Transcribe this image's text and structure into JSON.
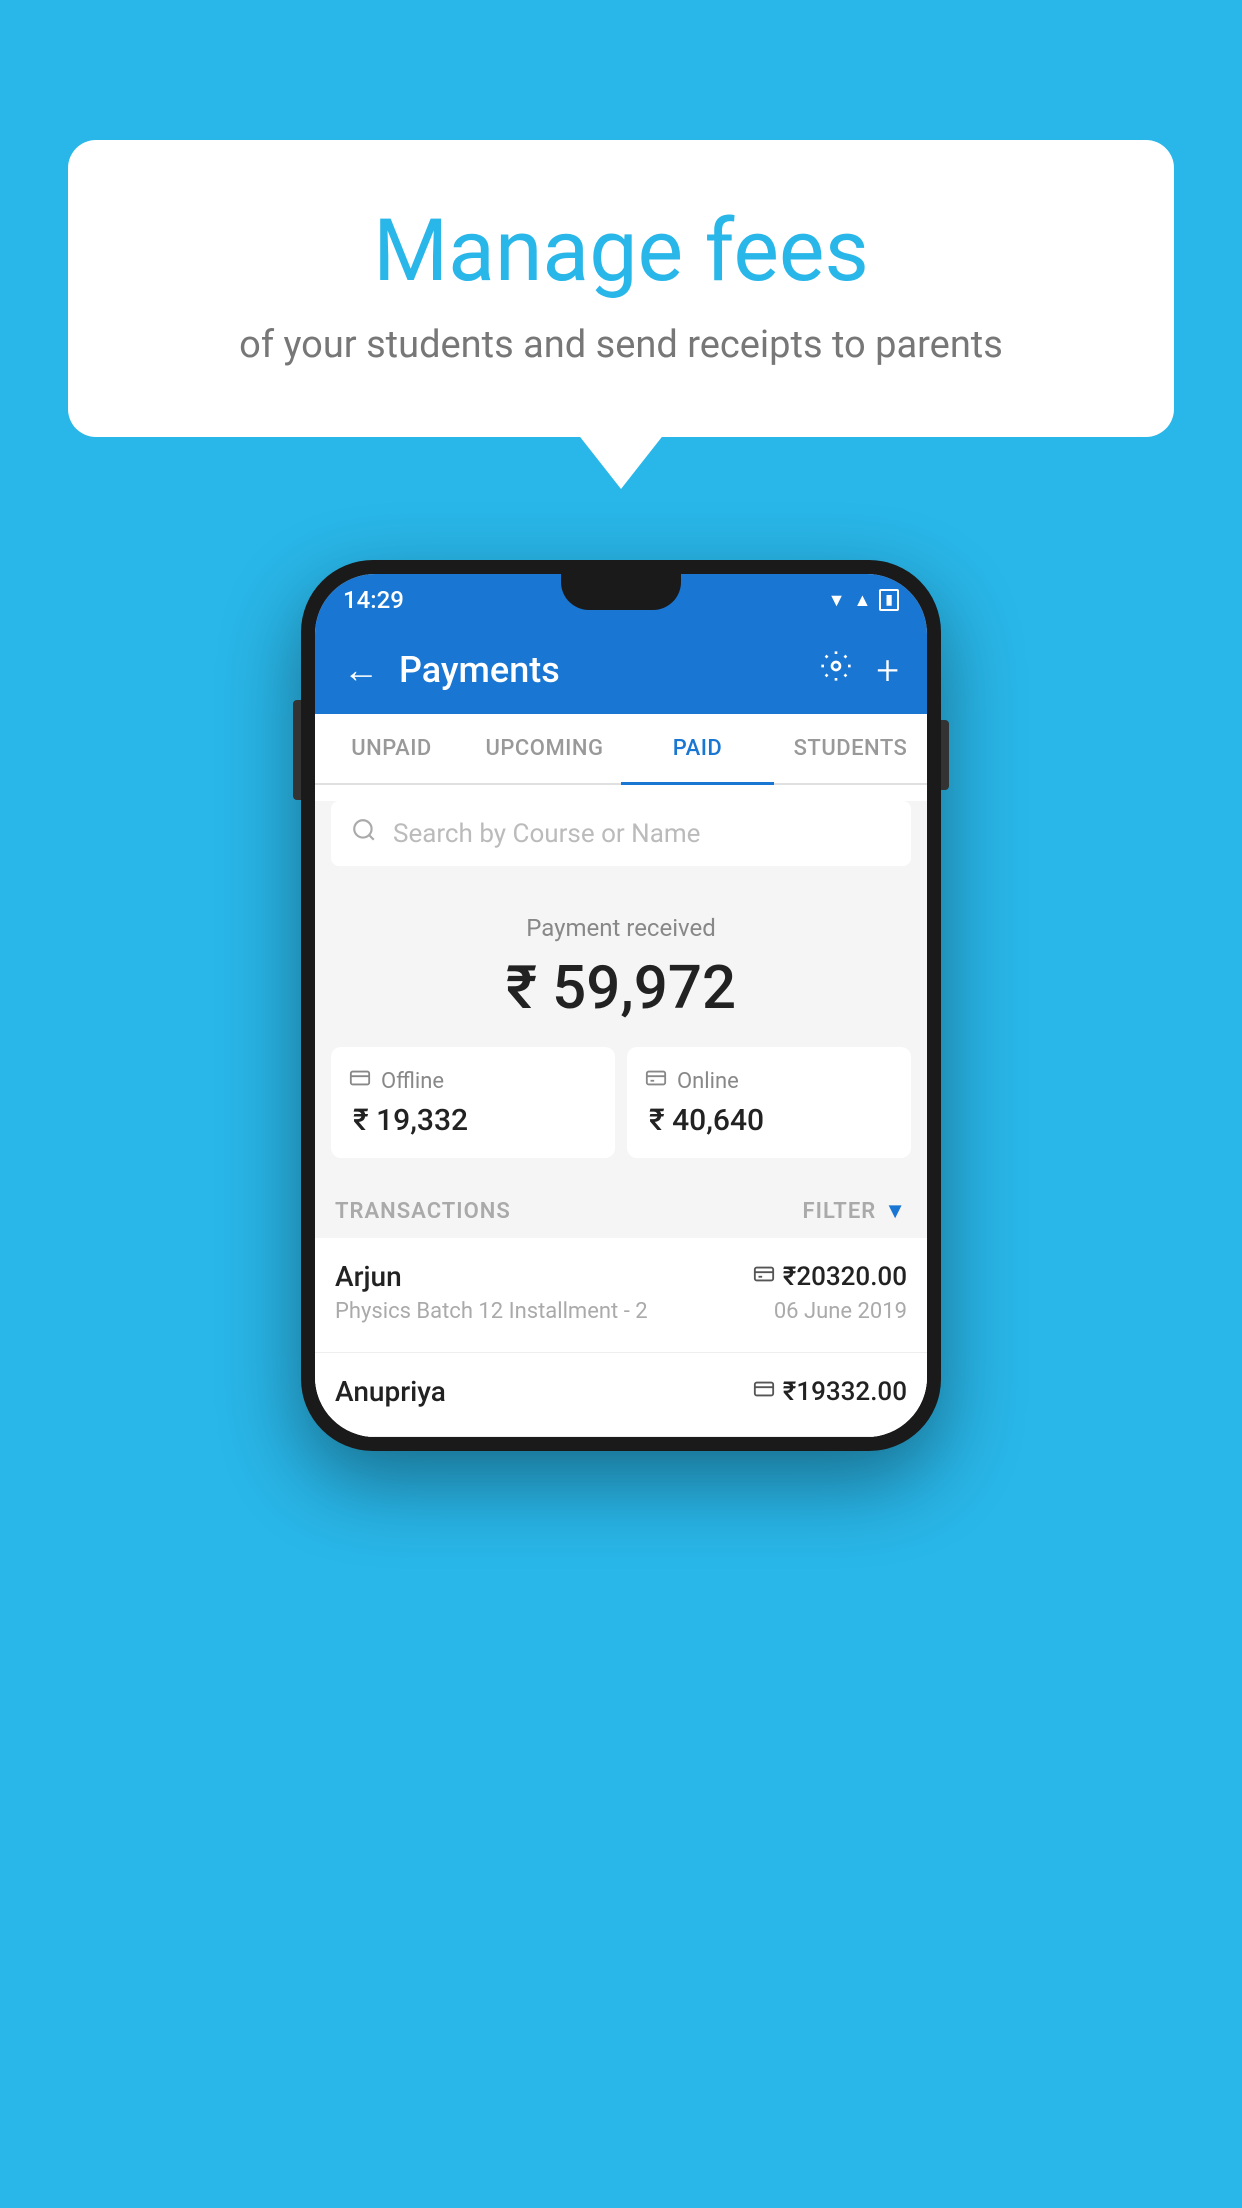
{
  "page": {
    "background_color": "#29B6E8"
  },
  "speech_bubble": {
    "title": "Manage fees",
    "subtitle": "of your students and send receipts to parents"
  },
  "status_bar": {
    "time": "14:29",
    "wifi_icon": "▲",
    "signal_icon": "▲",
    "battery_icon": "▮"
  },
  "app_header": {
    "back_label": "←",
    "title": "Payments",
    "settings_label": "⚙",
    "add_label": "+"
  },
  "tabs": [
    {
      "label": "UNPAID",
      "active": false
    },
    {
      "label": "UPCOMING",
      "active": false
    },
    {
      "label": "PAID",
      "active": true
    },
    {
      "label": "STUDENTS",
      "active": false
    }
  ],
  "search": {
    "placeholder": "Search by Course or Name",
    "icon": "🔍"
  },
  "payment_summary": {
    "label": "Payment received",
    "amount": "₹ 59,972"
  },
  "payment_cards": [
    {
      "type": "offline",
      "icon": "💳",
      "label": "Offline",
      "amount": "₹ 19,332"
    },
    {
      "type": "online",
      "icon": "💳",
      "label": "Online",
      "amount": "₹ 40,640"
    }
  ],
  "transactions_section": {
    "label": "TRANSACTIONS",
    "filter_label": "FILTER",
    "filter_icon": "▼"
  },
  "transactions": [
    {
      "name": "Arjun",
      "detail": "Physics Batch 12 Installment - 2",
      "amount": "₹20320.00",
      "date": "06 June 2019",
      "pay_type": "online"
    },
    {
      "name": "Anupriya",
      "detail": "",
      "amount": "₹19332.00",
      "date": "",
      "pay_type": "offline"
    }
  ]
}
